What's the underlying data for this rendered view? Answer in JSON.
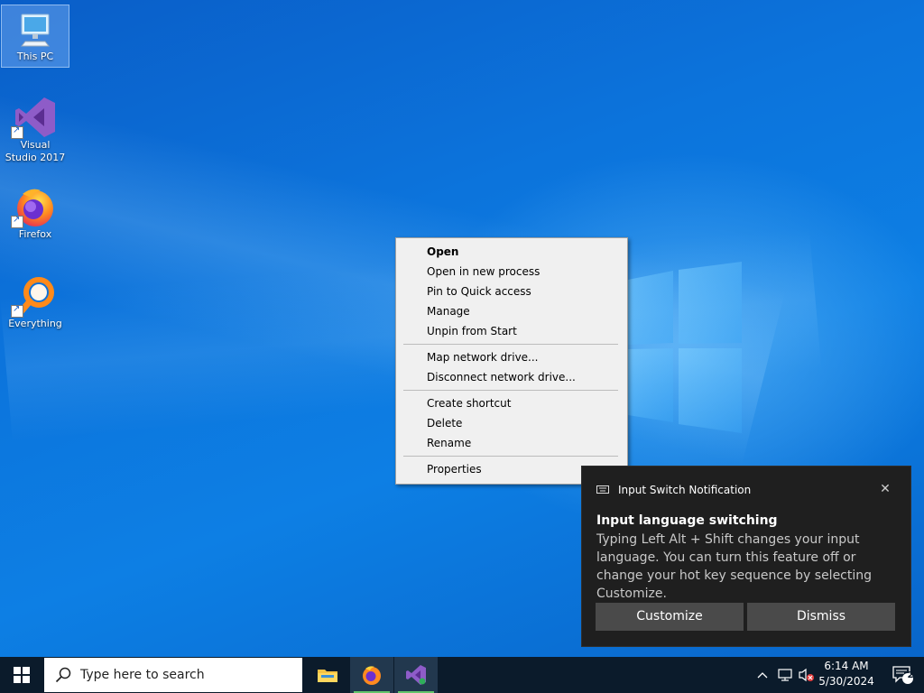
{
  "desktop": {
    "icons": [
      {
        "label": "This PC"
      },
      {
        "label": "Visual Studio 2017"
      },
      {
        "label": "Firefox"
      },
      {
        "label": "Everything"
      }
    ]
  },
  "context_menu": {
    "groups": [
      [
        "Open",
        "Open in new process",
        "Pin to Quick access",
        "Manage",
        "Unpin from Start"
      ],
      [
        "Map network drive...",
        "Disconnect network drive..."
      ],
      [
        "Create shortcut",
        "Delete",
        "Rename"
      ],
      [
        "Properties"
      ]
    ]
  },
  "notification": {
    "header": "Input Switch Notification",
    "title": "Input language switching",
    "body": "Typing Left Alt + Shift changes your input language. You can turn this feature off or change your hot key sequence by selecting Customize.",
    "customize_label": "Customize",
    "dismiss_label": "Dismiss"
  },
  "taskbar": {
    "search_placeholder": "Type here to search",
    "apps": [
      {
        "icon": "file-explorer-icon"
      },
      {
        "icon": "firefox-icon"
      },
      {
        "icon": "visual-studio-icon"
      }
    ],
    "time": "6:14 AM",
    "date": "5/30/2024",
    "notification_count": "2"
  },
  "colors": {
    "accent_green": "#63c56b",
    "desktop_blue": "#0d7fe4"
  }
}
